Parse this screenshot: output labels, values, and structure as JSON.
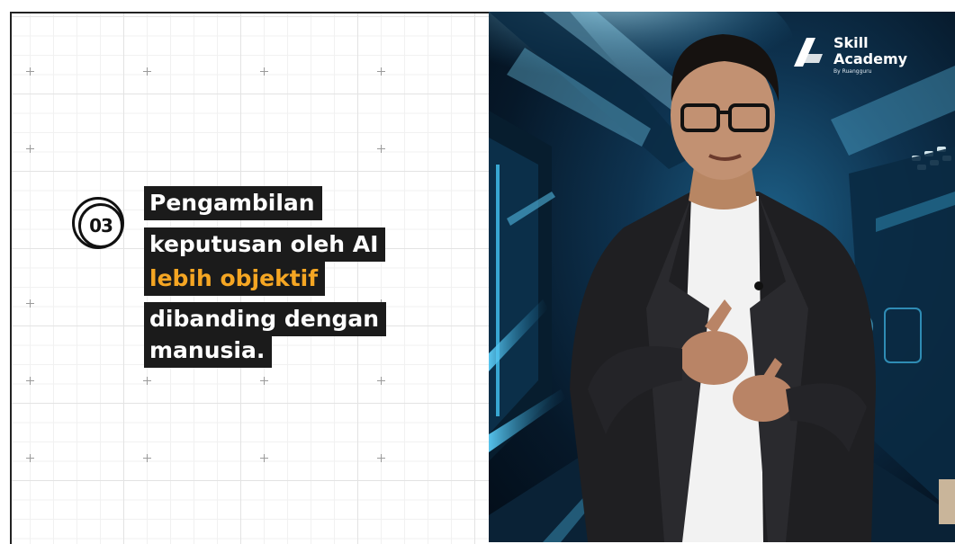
{
  "slide": {
    "number": "03",
    "lines": [
      {
        "text": "Pengambilan",
        "highlight": false
      },
      {
        "text": "keputusan oleh AI",
        "highlight": false
      },
      {
        "text": "lebih objektif",
        "highlight": true
      },
      {
        "text": "dibanding dengan",
        "highlight": false
      },
      {
        "text": "manusia.",
        "highlight": false
      }
    ]
  },
  "brand": {
    "line1": "Skill",
    "line2": "Academy",
    "tagline": "By Ruangguru"
  },
  "colors": {
    "highlight": "#f5a623",
    "text_box": "#1b1b1b",
    "scene": "#0e3350"
  }
}
